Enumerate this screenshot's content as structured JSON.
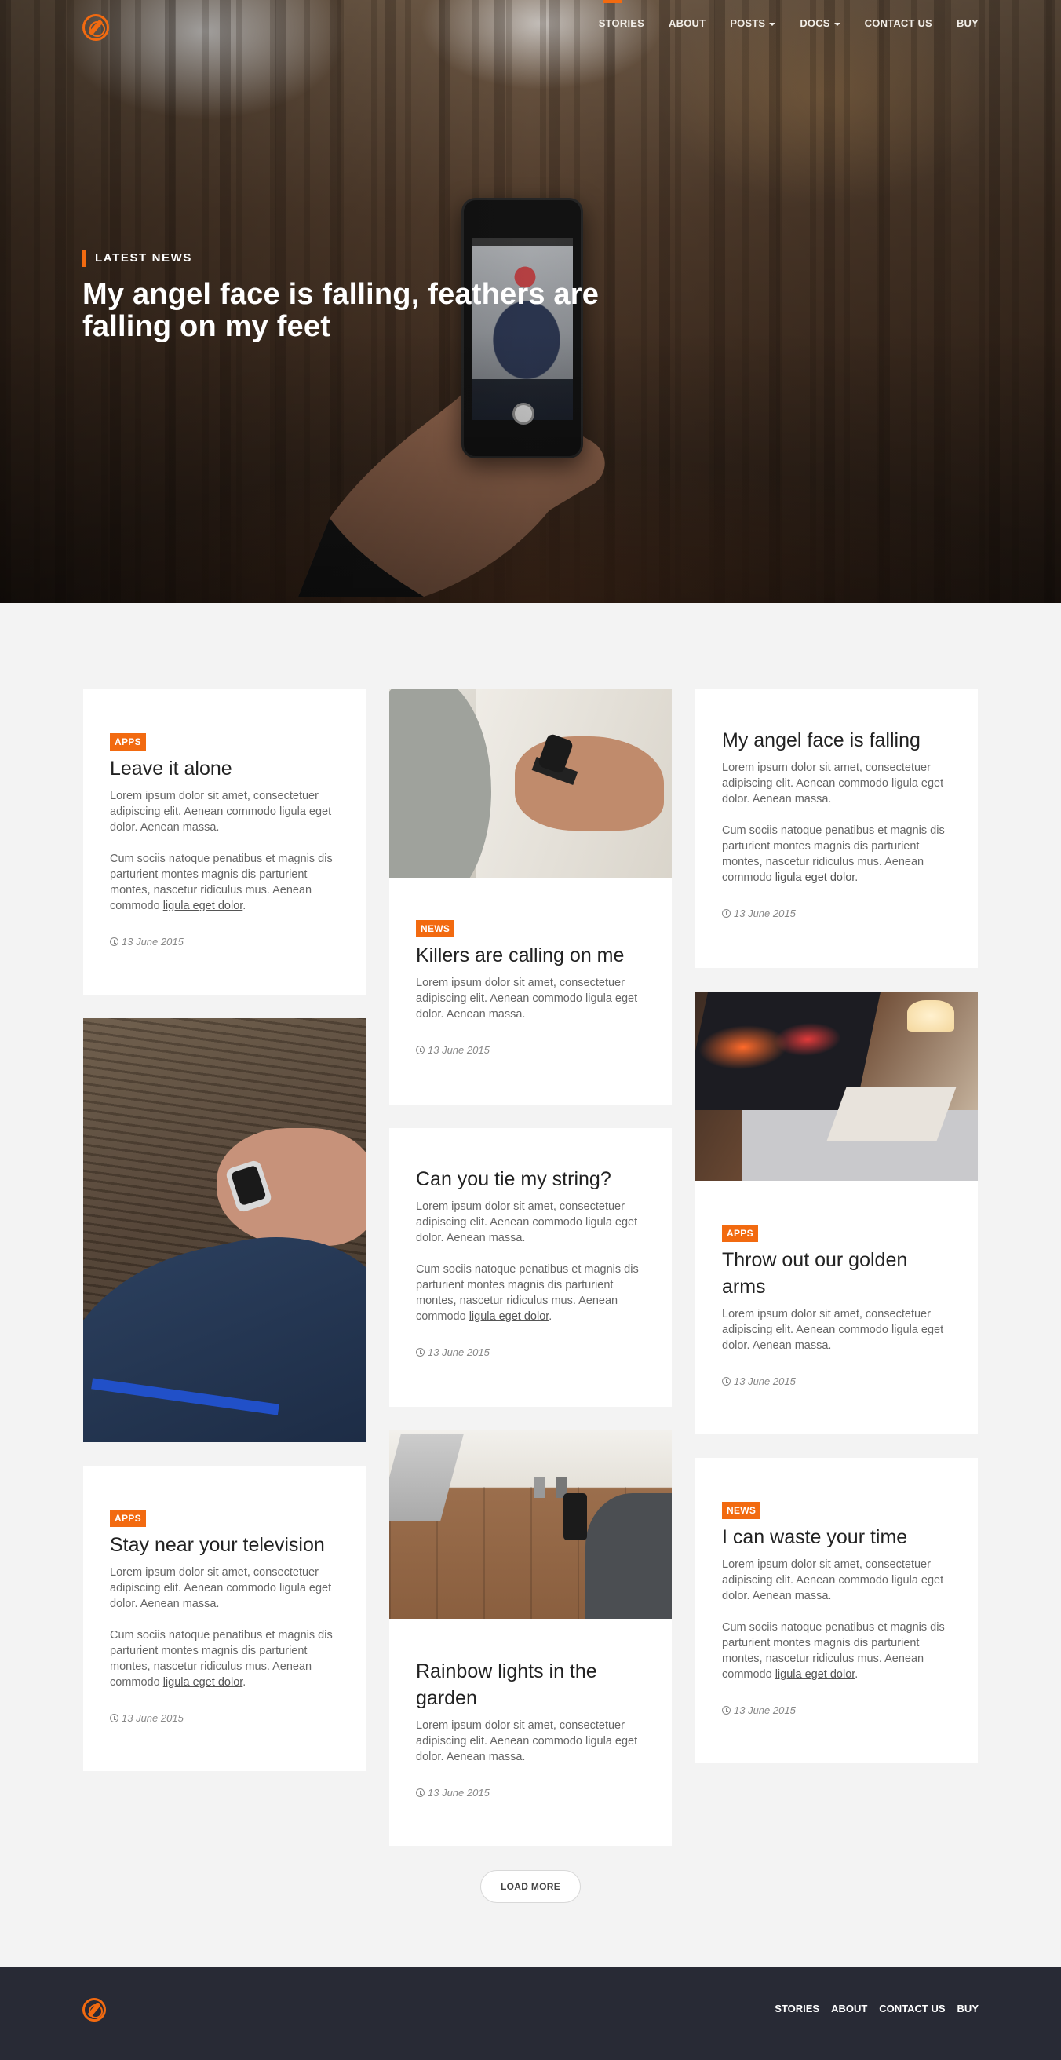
{
  "nav": {
    "items": [
      {
        "label": "STORIES"
      },
      {
        "label": "ABOUT"
      },
      {
        "label": "POSTS"
      },
      {
        "label": "DOCS"
      },
      {
        "label": "CONTACT US"
      },
      {
        "label": "BUY"
      }
    ]
  },
  "hero": {
    "kicker": "LATEST NEWS",
    "title": "My angel face is falling, feathers are falling on my feet"
  },
  "cards": [
    {
      "badge": "APPS",
      "title": "Leave it alone",
      "p1": "Lorem ipsum dolor sit amet, consectetuer adipiscing elit. Aenean commodo ligula eget dolor. Aenean massa.",
      "p2": "Cum sociis natoque penatibus et magnis dis parturient montes magnis dis parturient montes, nascetur ridiculus mus. Aenean commodo",
      "link": "ligula eget dolor",
      "date": "13 June 2015"
    },
    {
      "badge": "NEWS",
      "title": "Killers are calling on me",
      "p1": "Lorem ipsum dolor sit amet, consectetuer adipiscing elit. Aenean commodo ligula eget dolor. Aenean massa.",
      "date": "13 June 2015"
    },
    {
      "title": "My angel face is falling",
      "p1": "Lorem ipsum dolor sit amet, consectetuer adipiscing elit. Aenean commodo ligula eget dolor. Aenean massa.",
      "p2": "Cum sociis natoque penatibus et magnis dis parturient montes magnis dis parturient montes, nascetur ridiculus mus. Aenean commodo",
      "link": "ligula eget dolor",
      "date": "13 June 2015"
    },
    {
      "title": "Can you tie my string?",
      "p1": "Lorem ipsum dolor sit amet, consectetuer adipiscing elit. Aenean commodo ligula eget dolor. Aenean massa.",
      "p2": "Cum sociis natoque penatibus et magnis dis parturient montes magnis dis parturient montes, nascetur ridiculus mus. Aenean commodo",
      "link": "ligula eget dolor",
      "date": "13 June 2015"
    },
    {
      "badge": "APPS",
      "title": "Throw out our golden arms",
      "p1": "Lorem ipsum dolor sit amet, consectetuer adipiscing elit. Aenean commodo ligula eget dolor. Aenean massa.",
      "date": "13 June 2015"
    },
    {
      "badge": "APPS",
      "title": "Stay near your television",
      "p1": "Lorem ipsum dolor sit amet, consectetuer adipiscing elit. Aenean commodo ligula eget dolor. Aenean massa.",
      "p2": "Cum sociis natoque penatibus et magnis dis parturient montes magnis dis parturient montes, nascetur ridiculus mus. Aenean commodo",
      "link": "ligula eget dolor",
      "date": "13 June 2015"
    },
    {
      "title": "Rainbow lights in the garden",
      "p1": "Lorem ipsum dolor sit amet, consectetuer adipiscing elit. Aenean commodo ligula eget dolor. Aenean massa.",
      "date": "13 June 2015"
    },
    {
      "badge": "NEWS",
      "title": "I can waste your time",
      "p1": "Lorem ipsum dolor sit amet, consectetuer adipiscing elit. Aenean commodo ligula eget dolor. Aenean massa.",
      "p2": "Cum sociis natoque penatibus et magnis dis parturient montes magnis dis parturient montes, nascetur ridiculus mus. Aenean commodo",
      "link": "ligula eget dolor",
      "date": "13 June 2015"
    }
  ],
  "load_more": "LOAD MORE",
  "footer": {
    "items": [
      {
        "label": "STORIES"
      },
      {
        "label": "ABOUT"
      },
      {
        "label": "CONTACT US"
      },
      {
        "label": "BUY"
      }
    ]
  },
  "colors": {
    "accent": "#f26a10",
    "footer_bg": "#282a35",
    "page_bg": "#f3f3f3"
  }
}
